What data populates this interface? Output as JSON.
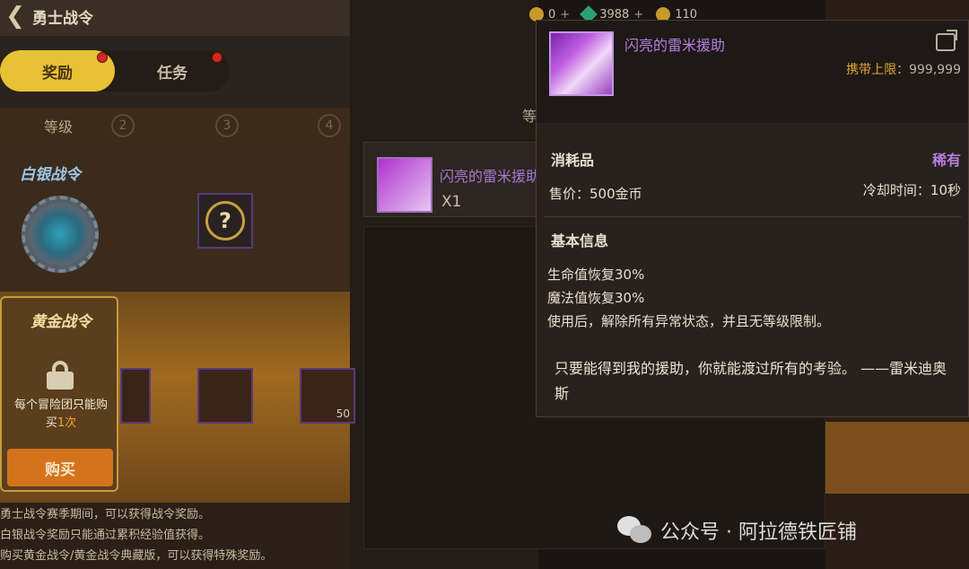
{
  "header": {
    "title": "勇士战令",
    "back_icon": "arrow-left-icon"
  },
  "currency": {
    "item1": "0",
    "item2": "3988",
    "item3": "110"
  },
  "tabs": [
    {
      "label": "奖励",
      "active": true,
      "badge": true
    },
    {
      "label": "任务",
      "active": false,
      "badge": true
    }
  ],
  "levels": {
    "label": "等级",
    "numbers": [
      "2",
      "3",
      "4"
    ]
  },
  "silver_pass": {
    "title": "白银战令"
  },
  "gold_pass": {
    "title": "黄金战令",
    "desc_pre": "每个冒险团只能购买",
    "desc_hl": "1次",
    "buy_label": "购买"
  },
  "reward_slot_qty": "50",
  "footer": [
    "勇士战令赛季期间，可以获得战令奖励。",
    "白银战令奖励只能通过累积经验值获得。",
    "购买黄金战令/黄金战令典藏版，可以获得特殊奖励。"
  ],
  "middle_panel": {
    "header": "等",
    "item_name": "闪亮的雷米援助",
    "qty": "X1"
  },
  "tooltip": {
    "item_name": "闪亮的雷米援助",
    "limit_label": "携带上限：",
    "limit_value": "999,999",
    "type": "消耗品",
    "rarity": "稀有",
    "price": "售价：500金币",
    "cooldown": "冷却时间：10秒",
    "basic_info_title": "基本信息",
    "effects": [
      "生命值恢复30%",
      "魔法值恢复30%",
      "使用后，解除所有异常状态，并且无等级限制。"
    ],
    "quote": "只要能得到我的援助，你就能渡过所有的考验。 ——雷米迪奥斯"
  },
  "watermark": {
    "text": "公众号 · 阿拉德铁匠铺"
  },
  "colors": {
    "rare_purple": "#b47ee0",
    "limit_gold": "#e0a830",
    "tab_active": "#e8c234",
    "buy_orange": "#d4731c"
  }
}
